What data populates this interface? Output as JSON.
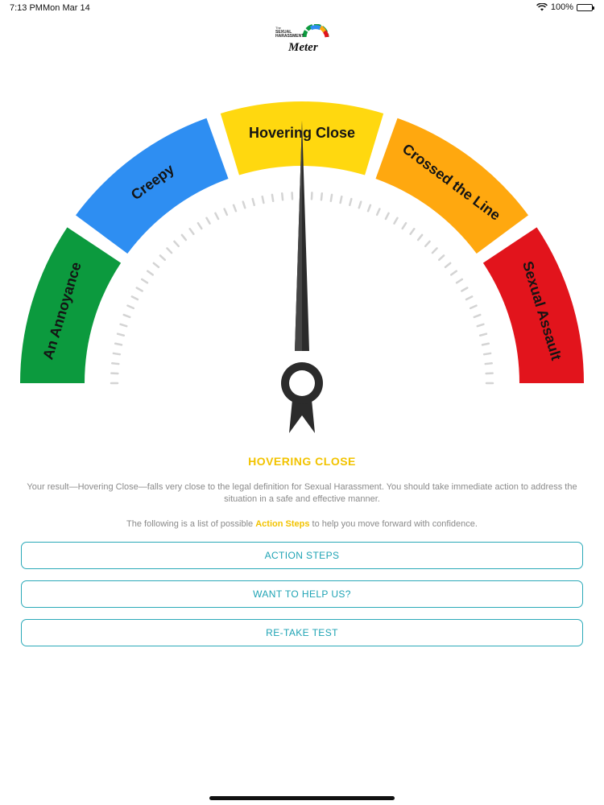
{
  "status_bar": {
    "time": "7:13 PM",
    "date": "Mon Mar 14",
    "battery": "100%",
    "battery_level": 1.0,
    "wifi_icon": "wifi-icon",
    "battery_icon": "battery-icon"
  },
  "logo": {
    "small_text": "The",
    "line1": "SEXUAL",
    "line2": "HARASSMENT",
    "word": "Meter"
  },
  "gauge": {
    "segments": [
      {
        "label": "An Annoyance",
        "color": "#0c9a3e"
      },
      {
        "label": "Creepy",
        "color": "#2e8ef2"
      },
      {
        "label": "Hovering Close",
        "color": "#ffd80f"
      },
      {
        "label": "Crossed the Line",
        "color": "#ffa80f"
      },
      {
        "label": "Sexual Assault",
        "color": "#e2141c"
      }
    ],
    "needle_value": 0.5,
    "needle_color": "#2b2b2b"
  },
  "result": {
    "title": "HOVERING CLOSE",
    "description": "Your result—Hovering Close—falls very close to the legal definition for Sexual Harassment. You should take immediate action to address the situation in a safe and effective manner.",
    "steps_prefix": "The following is a list of possible ",
    "steps_highlight": "Action Steps",
    "steps_suffix": " to help you move forward with confidence.",
    "accent_color": "#f2c300"
  },
  "buttons": {
    "action_steps": "ACTION STEPS",
    "help_us": "WANT TO HELP US?",
    "retake": "RE-TAKE TEST",
    "color": "#2aa9b8"
  }
}
